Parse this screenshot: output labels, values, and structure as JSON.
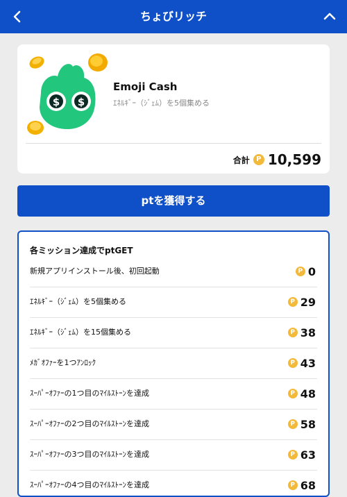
{
  "header": {
    "title": "ちょびリッチ",
    "back_icon": "chevron-left-icon",
    "collapse_icon": "chevron-up-icon",
    "color": "#0f4fc8"
  },
  "app": {
    "name": "Emoji Cash",
    "description": "ｴﾈﾙｷﾞｰ（ｼﾞｪﾑ）を5個集める",
    "icon": "emoji-cash-app-icon",
    "total_label": "合計",
    "total_value": "10,599",
    "coin_icon": "point-coin-icon",
    "coin_symbol": "P"
  },
  "cta": {
    "label": "ptを獲得する"
  },
  "missions": {
    "title": "各ミッション達成でptGET",
    "items": [
      {
        "label": "新規アプリインストール後、初回起動",
        "points": "0"
      },
      {
        "label": "ｴﾈﾙｷﾞｰ（ｼﾞｪﾑ）を5個集める",
        "points": "29"
      },
      {
        "label": "ｴﾈﾙｷﾞｰ（ｼﾞｪﾑ）を15個集める",
        "points": "38"
      },
      {
        "label": "ﾒｶﾞｵﾌｧｰを1つｱﾝﾛｯｸ",
        "points": "43"
      },
      {
        "label": "ｽｰﾊﾟｰｵﾌｧｰの1つ目のﾏｲﾙｽﾄｰﾝを達成",
        "points": "48"
      },
      {
        "label": "ｽｰﾊﾟｰｵﾌｧｰの2つ目のﾏｲﾙｽﾄｰﾝを達成",
        "points": "58"
      },
      {
        "label": "ｽｰﾊﾟｰｵﾌｧｰの3つ目のﾏｲﾙｽﾄｰﾝを達成",
        "points": "63"
      },
      {
        "label": "ｽｰﾊﾟｰｵﾌｧｰの4つ目のﾏｲﾙｽﾄｰﾝを達成",
        "points": "68"
      }
    ]
  }
}
